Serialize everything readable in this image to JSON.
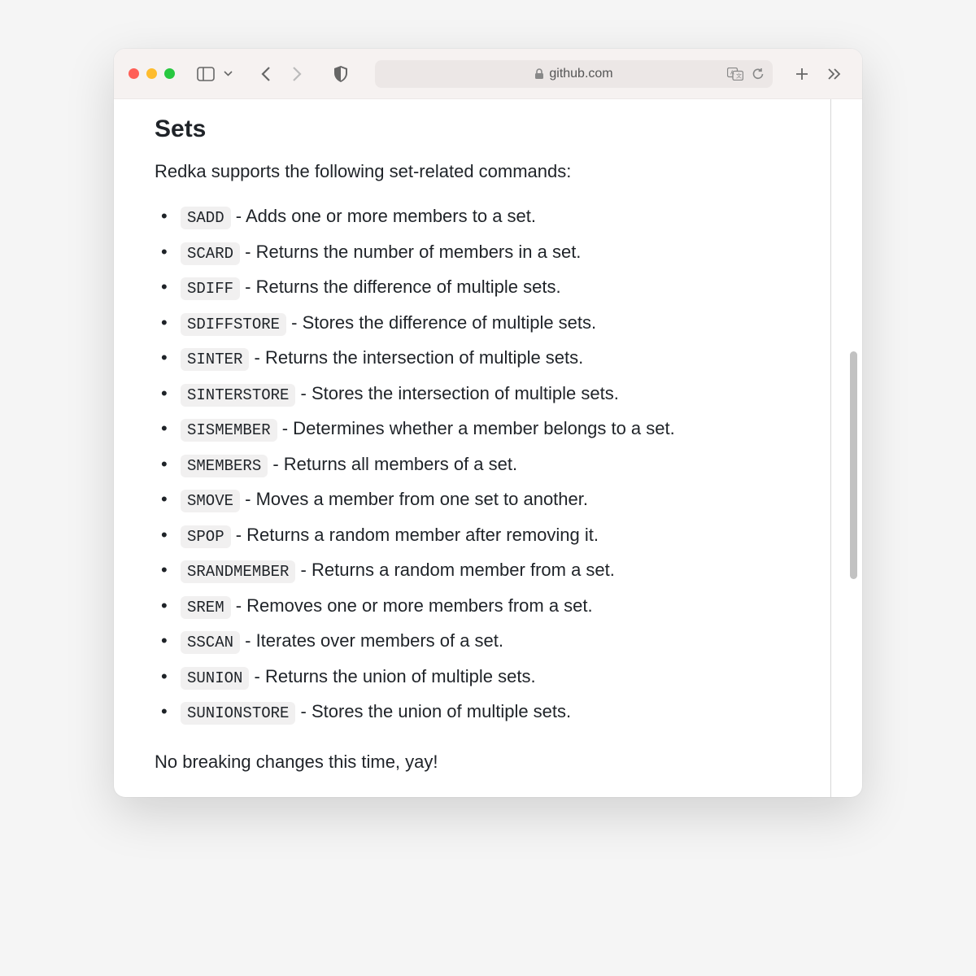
{
  "address": {
    "domain": "github.com"
  },
  "page": {
    "heading": "Sets",
    "intro": "Redka supports the following set-related commands:",
    "commands": [
      {
        "name": "SADD",
        "desc": "Adds one or more members to a set."
      },
      {
        "name": "SCARD",
        "desc": "Returns the number of members in a set."
      },
      {
        "name": "SDIFF",
        "desc": "Returns the difference of multiple sets."
      },
      {
        "name": "SDIFFSTORE",
        "desc": "Stores the difference of multiple sets."
      },
      {
        "name": "SINTER",
        "desc": "Returns the intersection of multiple sets."
      },
      {
        "name": "SINTERSTORE",
        "desc": "Stores the intersection of multiple sets."
      },
      {
        "name": "SISMEMBER",
        "desc": "Determines whether a member belongs to a set."
      },
      {
        "name": "SMEMBERS",
        "desc": "Returns all members of a set."
      },
      {
        "name": "SMOVE",
        "desc": "Moves a member from one set to another."
      },
      {
        "name": "SPOP",
        "desc": "Returns a random member after removing it."
      },
      {
        "name": "SRANDMEMBER",
        "desc": "Returns a random member from a set."
      },
      {
        "name": "SREM",
        "desc": "Removes one or more members from a set."
      },
      {
        "name": "SSCAN",
        "desc": "Iterates over members of a set."
      },
      {
        "name": "SUNION",
        "desc": "Returns the union of multiple sets."
      },
      {
        "name": "SUNIONSTORE",
        "desc": "Stores the union of multiple sets."
      }
    ],
    "closing": "No breaking changes this time, yay!"
  }
}
